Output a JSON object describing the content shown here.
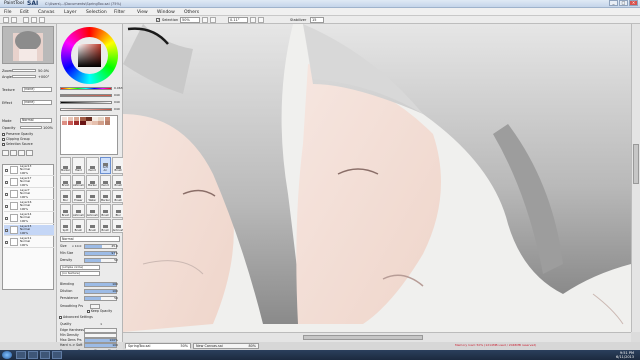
{
  "window": {
    "app_name": "PaintTool",
    "app_logo": "SAI",
    "path": "C:\\Users\\...\\Documents\\SpringToo.sai (75%)",
    "controls": [
      "_",
      "□",
      "×"
    ]
  },
  "menu": [
    "File",
    "Edit",
    "Canvas",
    "Layer",
    "Selection",
    "Filter",
    "View",
    "Window",
    "Others"
  ],
  "toolbar": {
    "selection_label": "Selection",
    "zoom": "50%",
    "angle": "0.11°",
    "stabilizer_label": "Stabilizer",
    "stabilizer_value": "15"
  },
  "navigator": {
    "zoom_label": "Zoom",
    "zoom_value": "50.0%",
    "angle_label": "Angle",
    "angle_value": "+000°"
  },
  "layer_props": {
    "texture_label": "Texture",
    "texture_value": "(none)",
    "effect_label": "Effect",
    "effect_value": "(none)",
    "mode_label": "Mode",
    "mode_value": "Normal",
    "opacity_label": "Opacity",
    "opacity_value": "100%",
    "checks": [
      "Preserve Opacity",
      "Clipping Group",
      "Selection Source"
    ]
  },
  "layers": [
    {
      "name": "Layer13",
      "mode": "Normal",
      "opacity": "100%"
    },
    {
      "name": "Layer17",
      "mode": "Normal",
      "opacity": "100%"
    },
    {
      "name": "Layer7",
      "mode": "Normal",
      "opacity": "100%"
    },
    {
      "name": "Layer16",
      "mode": "Normal",
      "opacity": "100%"
    },
    {
      "name": "Layer14",
      "mode": "Normal",
      "opacity": "100%"
    },
    {
      "name": "Layer15",
      "mode": "Normal",
      "opacity": "100%"
    },
    {
      "name": "Layer11",
      "mode": "Normal",
      "opacity": "100%"
    }
  ],
  "color_sliders": [
    {
      "value": "0.063"
    },
    {
      "value": "040"
    },
    {
      "value": "040"
    },
    {
      "value": "040"
    }
  ],
  "swatches": [
    "#f3e0d8",
    "#e9c6b8",
    "#d9a58f",
    "#a6604a",
    "#6c2f22",
    "#f6ece4",
    "#ead8c8",
    "#c98d77",
    "#ffffff",
    "#dd8f84",
    "#c75a55",
    "#9e2b2b",
    "#6a1414",
    "#f0d2c4",
    "#e6c0ae",
    "#d1a08b",
    "#b67f6a",
    "#ffffff",
    "#ffffff",
    "#ffffff",
    "#ffffff",
    "#ffffff",
    "#ffffff",
    "#ffffff",
    "#ffffff",
    "#ffffff",
    "#ffffff"
  ],
  "tools": [
    {
      "label": "Marker",
      "selected": false
    },
    {
      "label": "Hand",
      "selected": false
    },
    {
      "label": "Pencil",
      "selected": false
    },
    {
      "label": "Soft Air",
      "selected": true
    },
    {
      "label": "Brush",
      "selected": false
    },
    {
      "label": "Brush",
      "selected": false
    },
    {
      "label": "Airbrush",
      "selected": false
    },
    {
      "label": "Marker",
      "selected": false
    },
    {
      "label": "Pencil",
      "selected": false
    },
    {
      "label": "Brush",
      "selected": false
    },
    {
      "label": "Blur",
      "selected": false
    },
    {
      "label": "Eraser",
      "selected": false
    },
    {
      "label": "Water",
      "selected": false
    },
    {
      "label": "Marker",
      "selected": false
    },
    {
      "label": "Brush",
      "selected": false
    },
    {
      "label": "Brush",
      "selected": false
    },
    {
      "label": "Airbrush",
      "selected": false
    },
    {
      "label": "Airbrush",
      "selected": false
    },
    {
      "label": "Brush",
      "selected": false
    },
    {
      "label": "Blur",
      "selected": false
    },
    {
      "label": "Split",
      "selected": false
    },
    {
      "label": "Brush",
      "selected": false
    },
    {
      "label": "Brush",
      "selected": false
    },
    {
      "label": "Brush",
      "selected": false
    },
    {
      "label": "Airbrush",
      "selected": false
    }
  ],
  "brush": {
    "mode": "Normal",
    "size_label": "Size",
    "size_mult": "x 10.0",
    "size_value": "45.0",
    "minsize_label": "Min Size",
    "minsize_value": "97%",
    "density_label": "Density",
    "density_value": "52",
    "shape": "(simple circle)",
    "texture": "(no texture)",
    "blending_label": "Blending",
    "blending_value": "100",
    "dilution_label": "Dilution",
    "dilution_value": "100",
    "persistence_label": "Persistence",
    "persistence_value": "50",
    "smoothing_label": "Smoothing Prs",
    "keep_opacity": "Keep Opacity",
    "advanced": "Advanced Settings",
    "quality_label": "Quality",
    "quality_value": "1",
    "edge_label": "Edge Hardness",
    "mindens_label": "Min Density",
    "maxdens_label": "Max Dens Prs",
    "maxdens_value": "100%",
    "hard_label": "Hard <-> Soft",
    "hard_value": "100",
    "press_label": "Press",
    "press_opts": [
      "Dens",
      "Size",
      "Blend"
    ]
  },
  "tabs": [
    {
      "name": "SpringToo.sai",
      "zoom": "50%"
    },
    {
      "name": "New Canvas.sai",
      "zoom": "80%"
    }
  ],
  "status": "Memory load: 50% (1214MB used / 2048MB reserved)",
  "clock": {
    "time": "9:51 PM",
    "date": "6/11/2013"
  }
}
